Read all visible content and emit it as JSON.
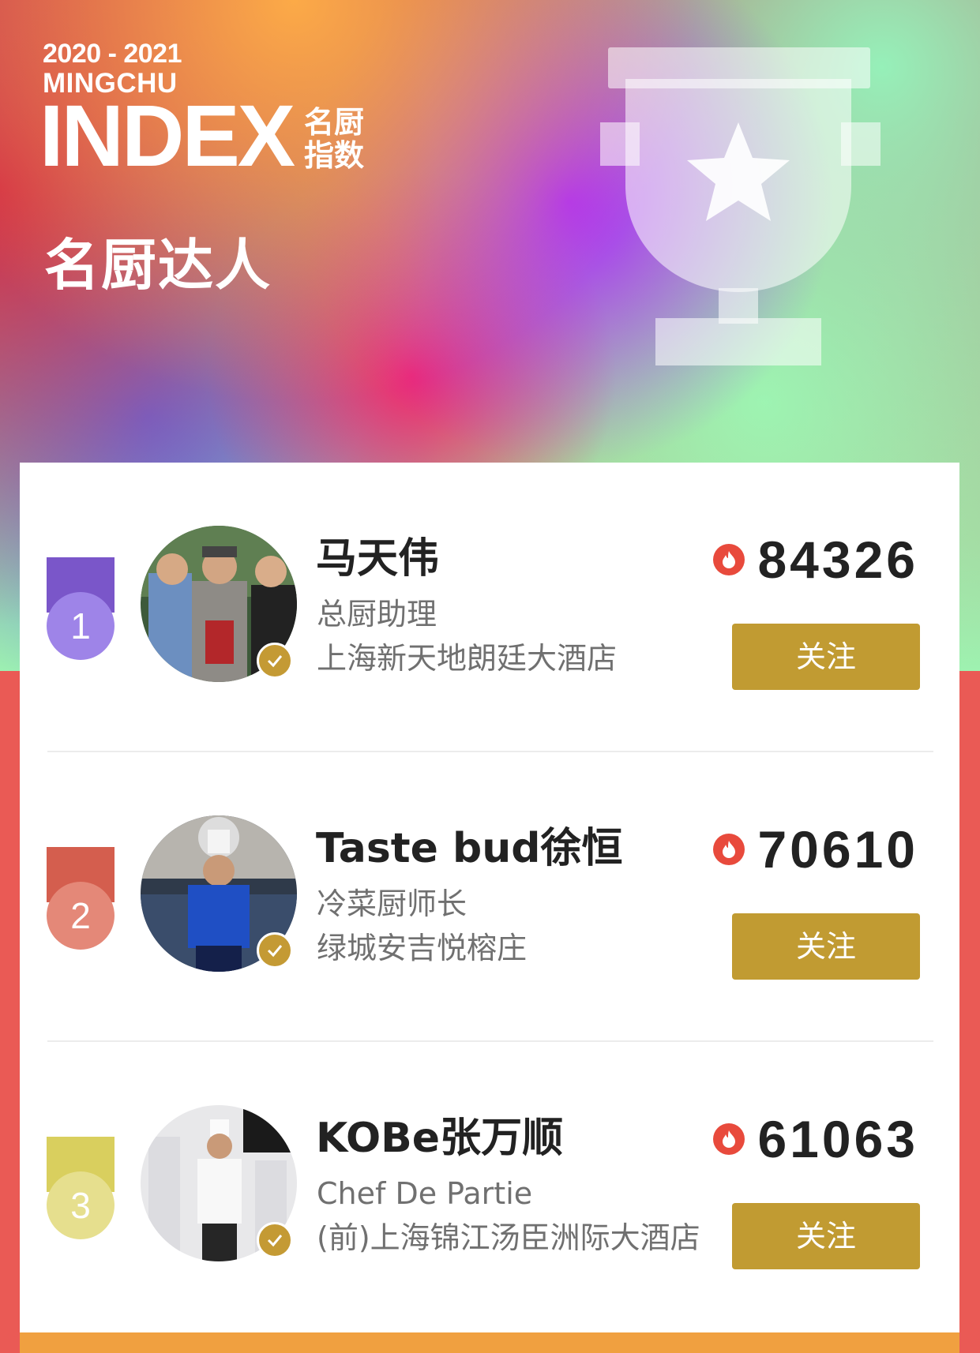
{
  "header": {
    "years": "2020 - 2021",
    "brand": "MINGCHU",
    "index": "INDEX",
    "brand_cn": "名厨指数",
    "subtitle": "名厨达人"
  },
  "colors": {
    "gold_button": "#c19b32",
    "verified_badge": "#c49a34",
    "fire": "#e84a3c",
    "page_background": "#ea5a55"
  },
  "follow_label": "关注",
  "rankings": [
    {
      "rank": "1",
      "medal_color": "#9e84e8",
      "ribbon_color": "#7a56c9",
      "name": "马天伟",
      "title": "总厨助理",
      "company": "上海新天地朗廷大酒店",
      "score": "84326",
      "avatar": "chef-photo-1",
      "verified": true
    },
    {
      "rank": "2",
      "medal_color": "#e48878",
      "ribbon_color": "#d45e4e",
      "name": "Taste bud徐恒",
      "title": "冷菜厨师长",
      "company": "绿城安吉悦榕庄",
      "score": "70610",
      "avatar": "chef-photo-2",
      "verified": true
    },
    {
      "rank": "3",
      "medal_color": "#e6df8e",
      "ribbon_color": "#d9cf5e",
      "name": "KOBe张万顺",
      "title": "Chef De Partie",
      "company": "(前)上海锦江汤臣洲际大酒店",
      "score": "61063",
      "avatar": "chef-photo-3",
      "verified": true
    }
  ]
}
